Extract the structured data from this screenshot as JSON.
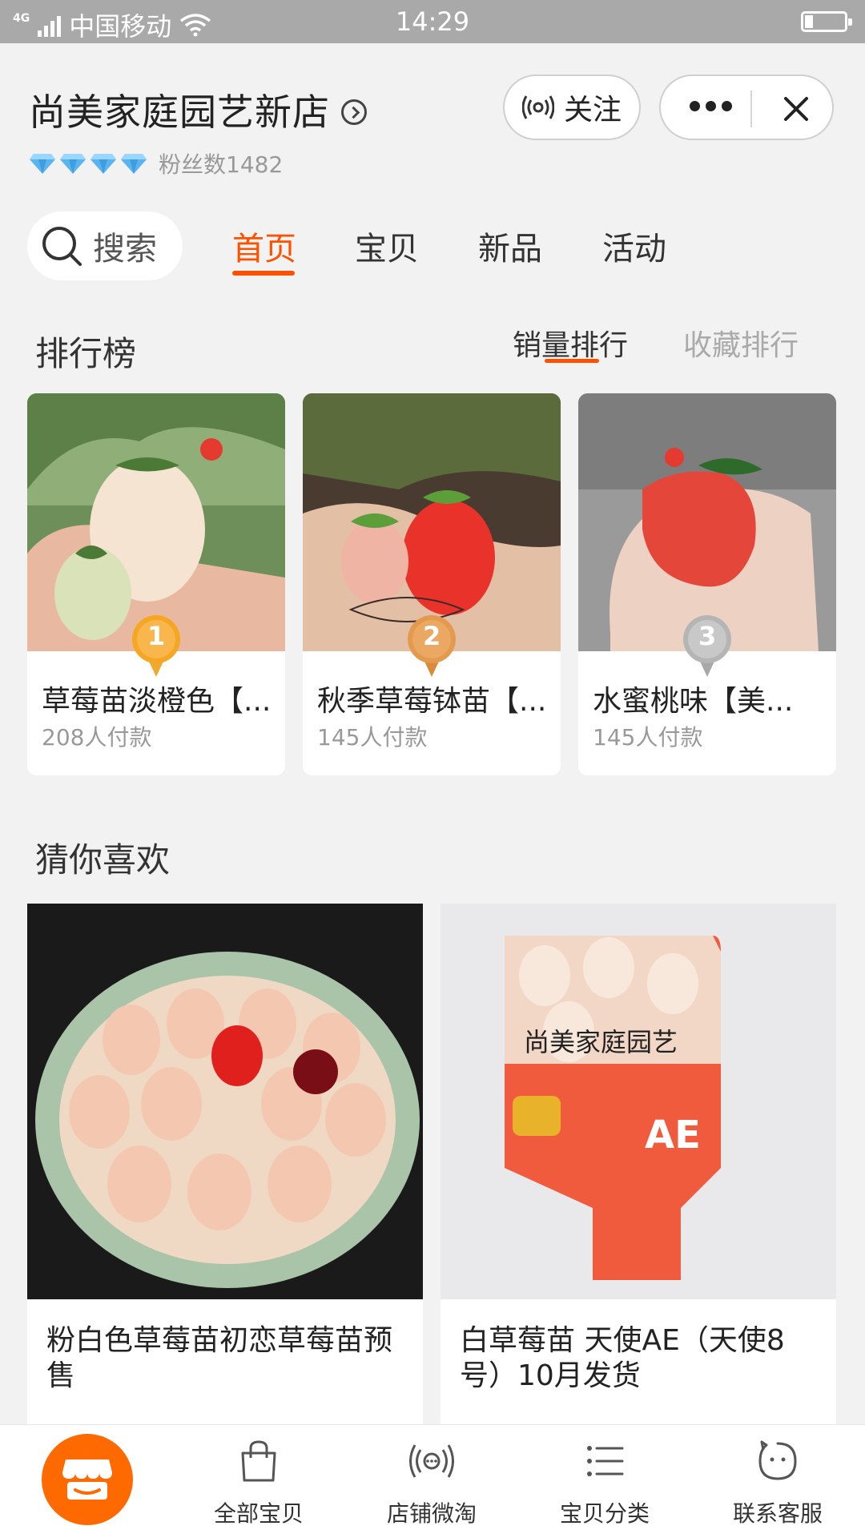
{
  "status_bar": {
    "network": "4G",
    "carrier": "中国移动",
    "time": "14:29"
  },
  "shop": {
    "name": "尚美家庭园艺新店",
    "fans": "粉丝数1482",
    "follow_label": "关注"
  },
  "nav": {
    "search_label": "搜索",
    "tabs": [
      {
        "label": "首页",
        "active": true
      },
      {
        "label": "宝贝",
        "active": false
      },
      {
        "label": "新品",
        "active": false
      },
      {
        "label": "活动",
        "active": false
      }
    ]
  },
  "ranking": {
    "title": "排行榜",
    "tabs": [
      {
        "label": "销量排行",
        "active": true
      },
      {
        "label": "收藏排行",
        "active": false
      }
    ],
    "items": [
      {
        "rank": "1",
        "title": "草莓苗淡橙色【...",
        "sales": "208人付款"
      },
      {
        "rank": "2",
        "title": "秋季草莓钵苗【...",
        "sales": "145人付款"
      },
      {
        "rank": "3",
        "title": "水蜜桃味【美...",
        "sales": "145人付款"
      }
    ]
  },
  "guess": {
    "title": "猜你喜欢",
    "items": [
      {
        "title": "粉白色草莓苗初恋草莓苗预售",
        "image_caption": ""
      },
      {
        "title": "白草莓苗  天使AE（天使8号）10月发货",
        "image_caption": "尚美家庭园艺"
      }
    ]
  },
  "bottom_tabs": [
    {
      "label": "全部宝贝",
      "icon": "shopping-bag-icon"
    },
    {
      "label": "店铺微淘",
      "icon": "broadcast-icon"
    },
    {
      "label": "宝贝分类",
      "icon": "list-icon"
    },
    {
      "label": "联系客服",
      "icon": "chat-face-icon"
    }
  ],
  "colors": {
    "accent": "#ff5000",
    "fab": "#ff6a00",
    "gold_medal": "#f5a623",
    "silver_medal": "#b5b5b5"
  }
}
